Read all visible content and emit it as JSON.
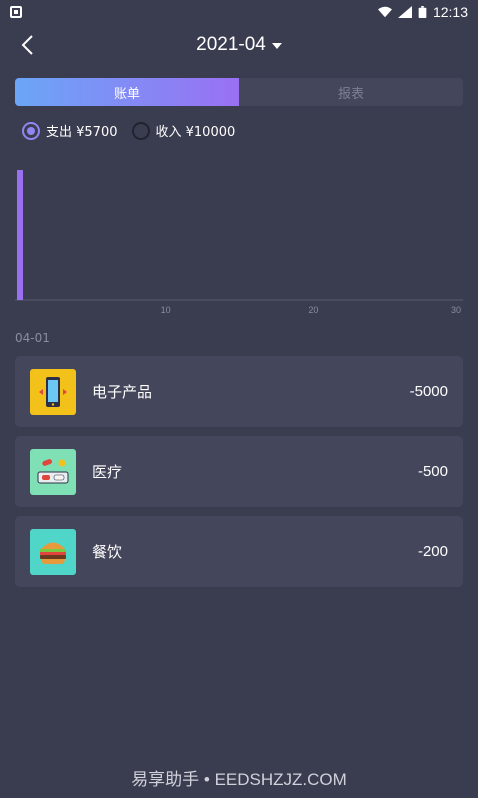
{
  "status_bar": {
    "time": "12:13"
  },
  "header": {
    "month": "2021-04"
  },
  "tabs": [
    {
      "label": "账单",
      "active": true
    },
    {
      "label": "报表",
      "active": false
    }
  ],
  "legend": {
    "expense_label": "支出 ¥5700",
    "income_label": "收入 ¥10000",
    "selected": "expense"
  },
  "colors": {
    "background": "#3a3c4f",
    "card": "#44465b",
    "accent_start": "#6ba6f7",
    "accent_end": "#9a70f3",
    "bar": "#9a70f3"
  },
  "chart_data": {
    "type": "bar",
    "x_ticks": [
      "10",
      "20",
      "30"
    ],
    "xlim": [
      0,
      30
    ],
    "x": [
      1
    ],
    "values": [
      5700
    ],
    "ylim": [
      0,
      5700
    ]
  },
  "date_group": "04-01",
  "transactions": [
    {
      "icon": "phone-icon",
      "name": "电子产品",
      "amount": "-5000",
      "icon_bg": "#f2c21b"
    },
    {
      "icon": "medicine-icon",
      "name": "医疗",
      "amount": "-500",
      "icon_bg": "#7fe0b6"
    },
    {
      "icon": "burger-icon",
      "name": "餐饮",
      "amount": "-200",
      "icon_bg": "#4fd6c8"
    }
  ],
  "watermark": "易享助手 • EEDSHZJZ.COM"
}
